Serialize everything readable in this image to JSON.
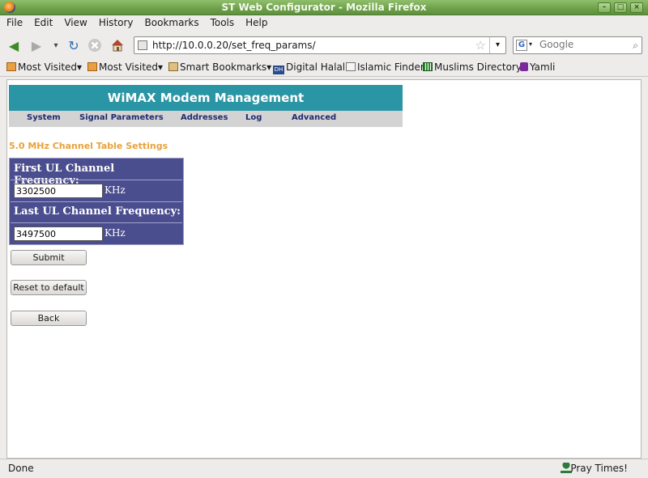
{
  "window": {
    "title": "ST Web Configurator - Mozilla Firefox"
  },
  "menu": [
    "File",
    "Edit",
    "View",
    "History",
    "Bookmarks",
    "Tools",
    "Help"
  ],
  "nav": {
    "url": "http://10.0.0.20/set_freq_params/",
    "search_placeholder": "Google"
  },
  "bookmarks": [
    "Most Visited",
    "Most Visited",
    "Smart Bookmarks",
    "Digital Halal",
    "Islamic Finder",
    "Muslims Directory",
    "Yamli"
  ],
  "page": {
    "banner": "WiMAX Modem Management",
    "tabs": [
      "System",
      "Signal Parameters",
      "Addresses",
      "Log",
      "Advanced"
    ],
    "section_title": "5.0 MHz Channel Table Settings",
    "first_label": "First UL Channel Frequency:",
    "first_value": "3302500",
    "last_label": "Last UL Channel Frequency:",
    "last_value": "3497500",
    "unit": "KHz",
    "buttons": {
      "submit": "Submit",
      "reset": "Reset to default",
      "back": "Back"
    }
  },
  "status": {
    "text": "Done",
    "addon": "Pray Times!"
  },
  "colors": {
    "banner": "#2a95a4",
    "table": "#4a4d8e",
    "section_title": "#e8a23a",
    "titlebar": "#6ea04a"
  }
}
